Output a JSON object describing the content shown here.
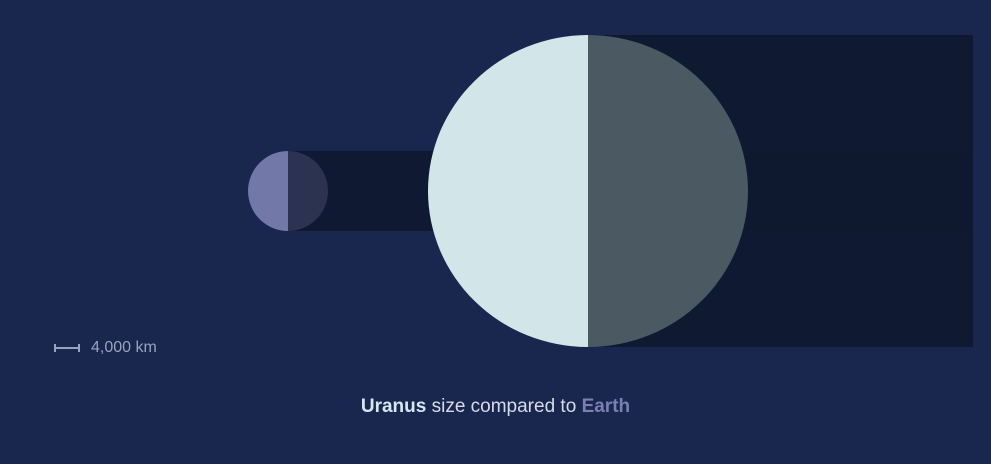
{
  "bodies": {
    "primary": {
      "name": "Uranus",
      "lit_color": "#d2e6ea",
      "shadow_color": "#4b5962"
    },
    "compared": {
      "name": "Earth",
      "lit_color": "#7278a7",
      "shadow_color": "#2c3350"
    }
  },
  "scale": {
    "icon": "scale-bar-icon",
    "label": "4,000 km"
  },
  "caption": {
    "primary": "Uranus",
    "middle": " size compared to ",
    "compared": "Earth"
  },
  "colors": {
    "background": "#19264e",
    "shadow_band": "#0e1a30"
  }
}
